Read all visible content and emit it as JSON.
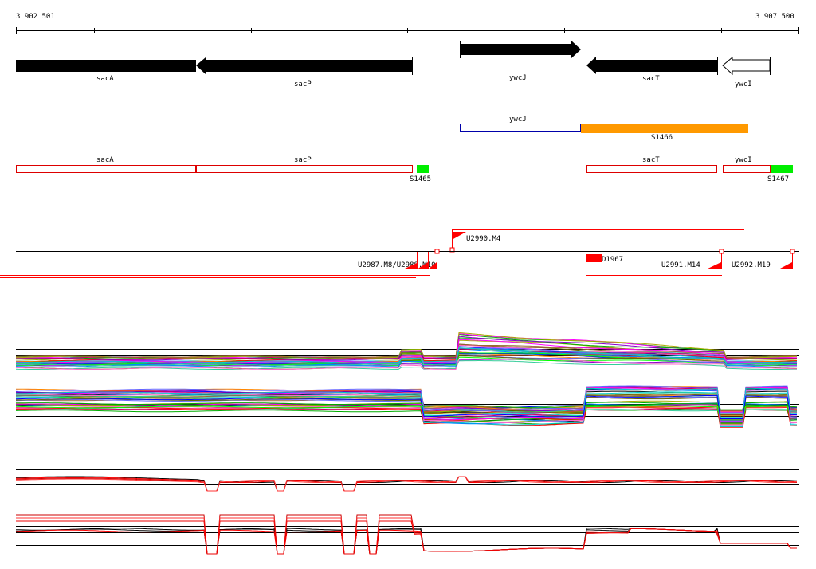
{
  "ruler": {
    "start_label": "3 902 501",
    "end_label": "3 907 500"
  },
  "genes": {
    "sacA": "sacA",
    "sacP": "sacP",
    "ywcJ": "ywcJ",
    "sacT": "sacT",
    "ywcI": "ywcI"
  },
  "segments": {
    "s1465": "S1465",
    "s1466": "S1466",
    "s1467": "S1467"
  },
  "features": {
    "u2990": "U2990.M4",
    "d1967": "D1967",
    "u2991": "U2991.M14",
    "u2992": "U2992.M19",
    "overlap": "U2987.M8/U2988.M10"
  },
  "colors": {
    "gene_fill": "#000000",
    "segment_outline": "#dd0000",
    "ywcJ_outline": "#0000aa",
    "s1466": "#ff9900",
    "green": "#00ee00",
    "marker_red": "#ff0000"
  }
}
